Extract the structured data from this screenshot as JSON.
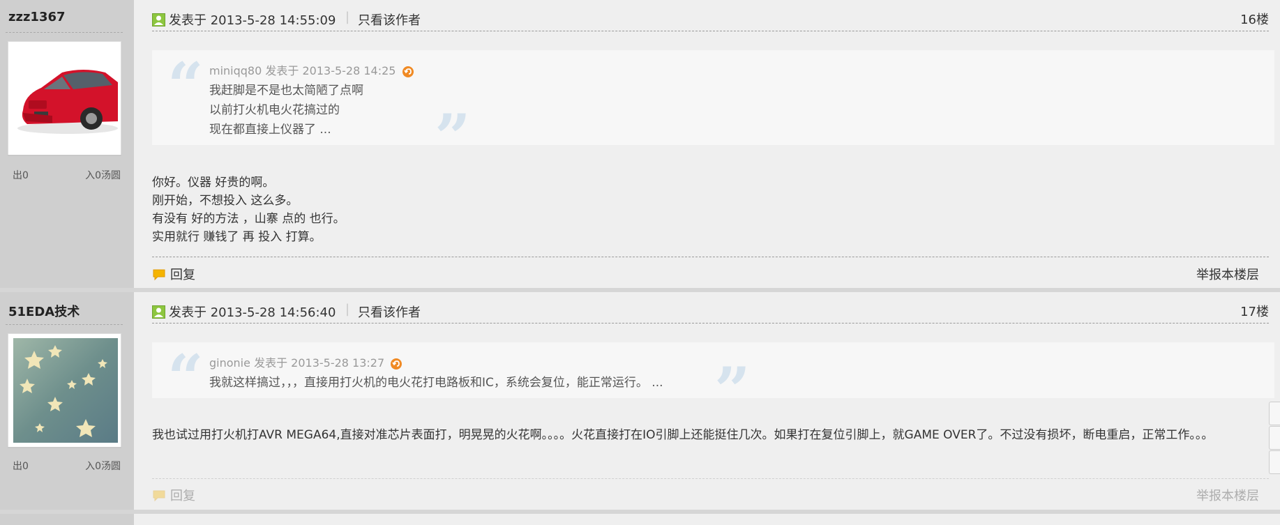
{
  "posts": [
    {
      "username": "zzz1367",
      "avatar": "red-car-avatar",
      "stat_out": "出0",
      "stat_in": "入0汤圆",
      "time": "发表于 2013-5-28 14:55:09",
      "only_author": "只看该作者",
      "floor": "16楼",
      "quote": {
        "author": "miniqq80",
        "meta": "发表于 2013-5-28 14:25",
        "lines": [
          "我赶脚是不是也太简陋了点啊",
          "以前打火机电火花搞过的",
          "现在都直接上仪器了 ..."
        ]
      },
      "body": [
        "你好。仪器 好贵的啊。",
        "刚开始，不想投入 这么多。",
        "有没有 好的方法 ，山寨 点的 也行。",
        "实用就行  赚钱了 再 投入 打算。"
      ],
      "reply_label": "回复",
      "report_label": "举报本楼层"
    },
    {
      "username": "51EDA技术",
      "avatar": "star-pattern-avatar",
      "stat_out": "出0",
      "stat_in": "入0汤圆",
      "time": "发表于 2013-5-28 14:56:40",
      "only_author": "只看该作者",
      "floor": "17楼",
      "quote": {
        "author": "ginonie",
        "meta": "发表于 2013-5-28 13:27",
        "lines": [
          "我就这样搞过，，，直接用打火机的电火花打电路板和IC，系统会复位，能正常运行。 ..."
        ]
      },
      "body": [
        "我也试过用打火机打AVR MEGA64,直接对准芯片表面打，明晃晃的火花啊。。。。火花直接打在IO引脚上还能挺住几次。如果打在复位引脚上，就GAME OVER了。不过没有损坏，断电重启，正常工作。。。"
      ],
      "reply_label": "回复",
      "report_label": "举报本楼层"
    }
  ],
  "colors": {
    "sidebar": "#cfcfcf",
    "main": "#efefef",
    "quote_bg": "#f7f7f7",
    "quote_mark": "#d6e3ee",
    "icon_green": "#7fbf3f",
    "back_icon": "#f08a24",
    "reply_icon": "#f5b400"
  }
}
